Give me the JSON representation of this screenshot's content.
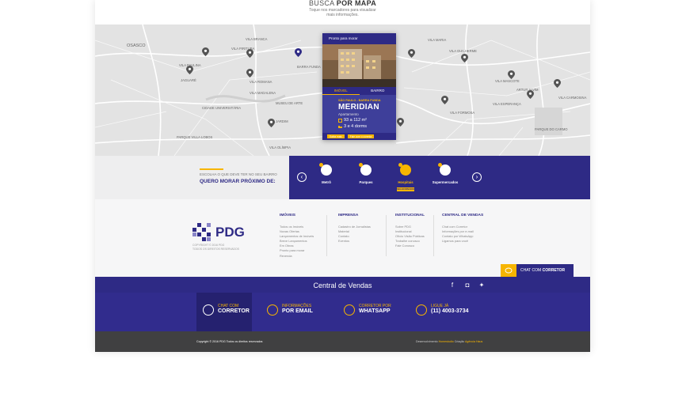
{
  "map": {
    "title_light": "BUSCA",
    "title_bold": "POR MAPA",
    "subtitle_line1": "Toque nos marcadores para visualizar",
    "subtitle_line2": "mais informações.",
    "labels": [
      "VILA BRANCA",
      "VILA PIRITUBA",
      "VILA ROMANA",
      "BARRA FUNDA",
      "VILA MARIA",
      "VILA FORMOSA",
      "OSASCO",
      "JAGUARÉ",
      "VILA MADALENA",
      "JARDIM",
      "VILA OLÍMPIA",
      "VILA PAULINA",
      "VILA MASCOTE",
      "VILA CARMOSINA",
      "VILA GUILHERME",
      "ARTUR ALVIM",
      "VILA ESPERANÇA",
      "PARQUE DO CARMO",
      "CIDADE UNIVERSITÁRIA",
      "MUSEU DE ARTE",
      "PARQUE VILLA LOBOS"
    ]
  },
  "popup": {
    "tag": "Pronto para morar",
    "tabs": [
      "IMÓVEL",
      "BAIRRO"
    ],
    "location": "SÃO PAULO - BARRA FUNDA",
    "name": "MERIDIAN",
    "type": "Apartamento",
    "area": "93 a 112 m²",
    "rooms": "3 e 4 dorms",
    "btn_details": "Saiba mais",
    "btn_contact": "Fale com o corretor"
  },
  "near": {
    "question": "ESCOLHA O QUE DEVE TER NO SEU BAIRRO",
    "heading": "QUERO MORAR PRÓXIMO DE:",
    "categories": [
      {
        "label": "Metrô",
        "icon": "train-icon"
      },
      {
        "label": "Parques",
        "icon": "tree-icon"
      },
      {
        "label": "Hospitais",
        "icon": "heart-icon",
        "badge": "SELECIONADO"
      },
      {
        "label": "Supermercados",
        "icon": "cart-icon"
      }
    ]
  },
  "footer": {
    "logo_text": "PDG",
    "copyright": "COPYRIGHT © 2016 PDG",
    "rights": "TODOS OS DIREITOS RESERVADOS",
    "cols": [
      {
        "title": "IMÓVEIS",
        "items": [
          "Todos os Imóveis",
          "Novas Ofertas",
          "Lançamentos de Imóveis",
          "Breve Lançamentos",
          "Em Obras",
          "Pronto para morar",
          "Revenda"
        ]
      },
      {
        "title": "IMPRENSA",
        "items": [
          "Cadastro de Jornalistas",
          "Material",
          "Contato",
          "Eventos"
        ]
      },
      {
        "title": "INSTITUCIONAL",
        "items": [
          "Sobre PDG",
          "Institucional",
          "Ofício Visão Públicas",
          "Trabalhe conosco",
          "Fale Conosco"
        ]
      },
      {
        "title": "CENTRAL DE VENDAS",
        "items": [
          "Chat com Corretor",
          "Informações por e-mail",
          "Contato por WhatsApp",
          "Ligamos para você"
        ]
      }
    ],
    "chat_prefix": "CHAT COM",
    "chat_bold": "CORRETOR"
  },
  "central": {
    "title": "Central de Vendas",
    "items": [
      {
        "l1": "CHAT COM",
        "l2": "CORRETOR"
      },
      {
        "l1": "INFORMAÇÕES",
        "l2": "POR EMAIL"
      },
      {
        "l1": "CORRETOR POR",
        "l2": "WHATSAPP"
      },
      {
        "l1": "LIGUE JÁ",
        "l2": "(11) 4003-3734"
      }
    ]
  },
  "bottom": {
    "copyright": "Copyright © 2016 PDG Todos os direitos reservados",
    "dev_prefix": "Desenvolvimento",
    "dev_brand": "Homestudio",
    "dev_mid": "Criação",
    "dev_agency": "Agência Haus"
  },
  "colors": {
    "brand": "#2e2a85",
    "accent": "#f7b500",
    "map": "#e3e3e3"
  }
}
